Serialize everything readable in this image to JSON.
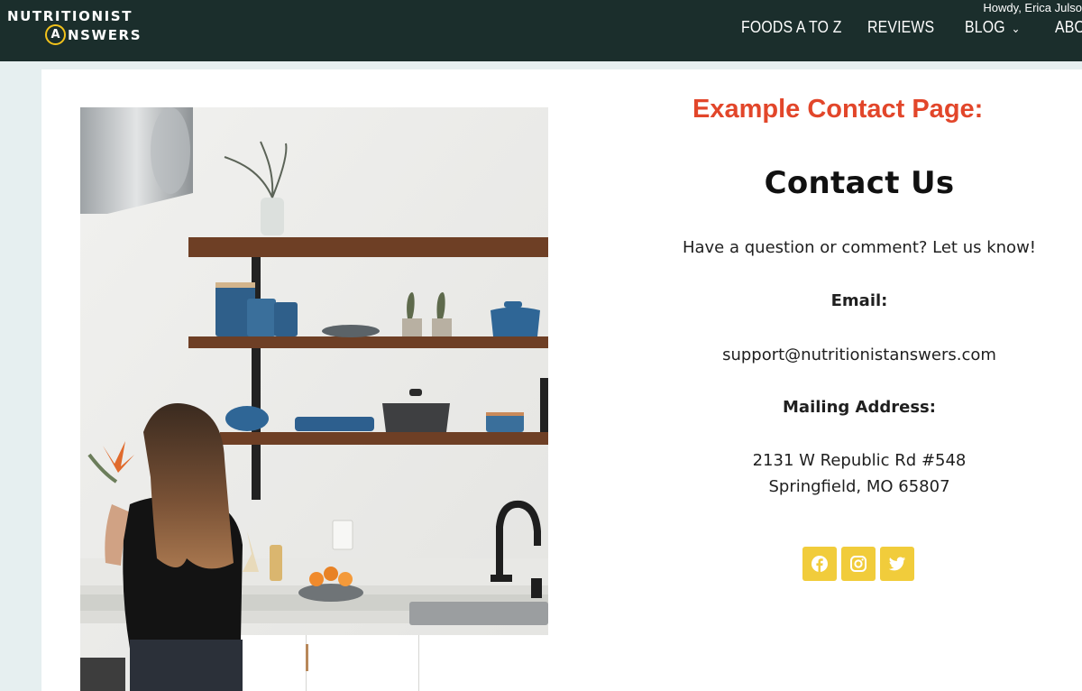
{
  "header": {
    "admin_greeting": "Howdy, Erica Julso",
    "logo": {
      "line1": "NUTRITIONIST",
      "line2_initial": "A",
      "line2_rest": "NSWERS"
    },
    "nav": [
      {
        "label": "FOODS A TO Z"
      },
      {
        "label": "REVIEWS"
      },
      {
        "label": "BLOG",
        "has_dropdown": true
      },
      {
        "label": "ABO"
      }
    ]
  },
  "content": {
    "example_title": "Example Contact Page:",
    "heading": "Contact Us",
    "intro": "Have a question or comment? Let us know!",
    "email_label": "Email:",
    "email_value": "support@nutritionistanswers.com",
    "address_label": "Mailing Address:",
    "address_line1": "2131 W Republic Rd #548",
    "address_line2": "Springfield, MO 65807",
    "socials": [
      {
        "icon": "facebook-icon"
      },
      {
        "icon": "instagram-icon"
      },
      {
        "icon": "twitter-icon"
      }
    ]
  },
  "colors": {
    "header_bg": "#1b2e2c",
    "accent_red": "#e2462a",
    "social_yellow": "#f1cc3b",
    "page_bg": "#e6eff0"
  }
}
